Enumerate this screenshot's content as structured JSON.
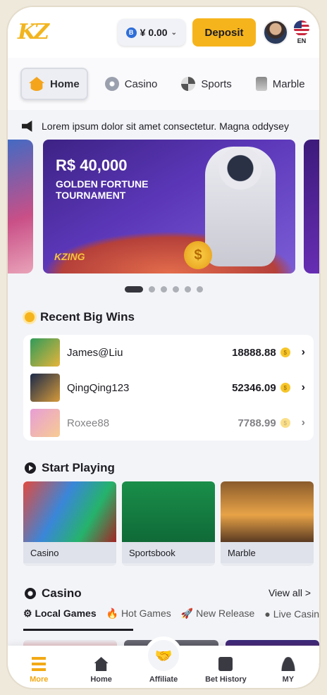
{
  "header": {
    "logo": "KZ",
    "balance": "¥ 0.00",
    "balance_coin_symbol": "B",
    "deposit_label": "Deposit",
    "language": "EN"
  },
  "tabs": [
    {
      "label": "Home",
      "active": true
    },
    {
      "label": "Casino"
    },
    {
      "label": "Sports"
    },
    {
      "label": "Marble"
    }
  ],
  "ticker": "Lorem ipsum dolor sit amet consectetur. Magna oddysey",
  "banner": {
    "amount": "R$ 40,000",
    "title": "GOLDEN FORTUNE TOURNAMENT",
    "brand": "KZING",
    "coin": "$",
    "pager_total": 6,
    "pager_active": 1
  },
  "recent_wins": {
    "title": "Recent Big Wins",
    "rows": [
      {
        "name": "James@Liu",
        "amount": "18888.88"
      },
      {
        "name": "QingQing123",
        "amount": "52346.09"
      },
      {
        "name": "Roxee88",
        "amount": "7788.99"
      }
    ]
  },
  "start_playing": {
    "title": "Start Playing",
    "cards": [
      {
        "label": "Casino"
      },
      {
        "label": "Sportsbook"
      },
      {
        "label": "Marble"
      }
    ]
  },
  "casino": {
    "title": "Casino",
    "view_all": "View all >",
    "tabs": [
      "Local Games",
      "Hot Games",
      "New Release",
      "Live Casino"
    ]
  },
  "bottom_nav": [
    {
      "label": "More",
      "active": true
    },
    {
      "label": "Home"
    },
    {
      "label": "Affiliate"
    },
    {
      "label": "Bet History"
    },
    {
      "label": "MY"
    }
  ],
  "colors": {
    "accent": "#f6b41c",
    "banner": "#5b37b8"
  }
}
